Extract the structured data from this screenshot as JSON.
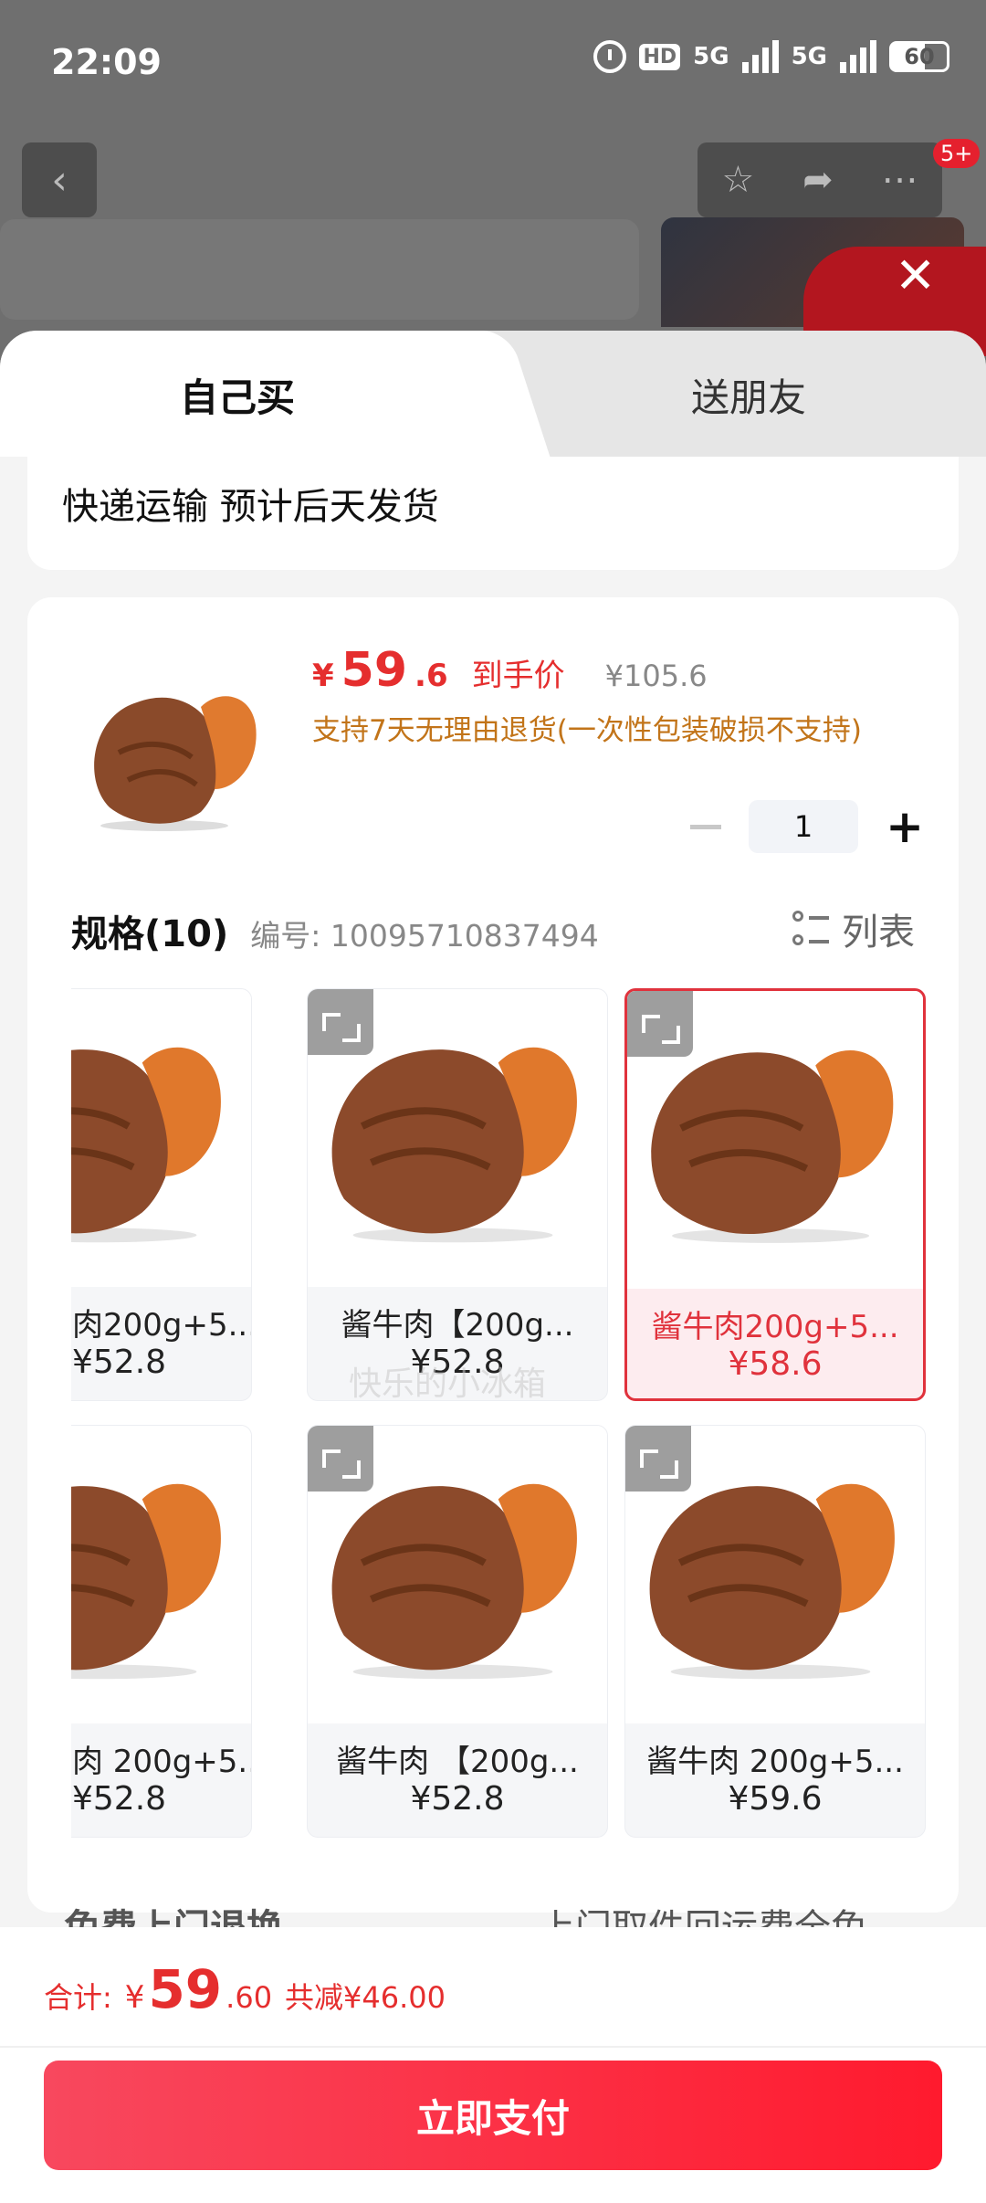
{
  "status_bar": {
    "time": "22:09",
    "hd_label": "HD",
    "net1": "5G",
    "net2": "5G",
    "battery": "60"
  },
  "background_page": {
    "back_icon": "chevron-left-icon",
    "badge": "5+"
  },
  "tabs": {
    "self": "自己买",
    "gift": "送朋友"
  },
  "shipping": {
    "text": "快递运输 预计后天发货"
  },
  "product": {
    "price_currency": "¥",
    "price_int": "59",
    "price_dec": ".6",
    "price_label": "到手价",
    "original_price": "¥105.6",
    "return_policy": "支持7天无理由退货(一次性包装破损不支持)",
    "quantity": "1"
  },
  "spec": {
    "title": "规格(10)",
    "code": "编号: 10095710837494",
    "list_toggle": "列表"
  },
  "skus": [
    {
      "name": "肉200g+5...",
      "price": "¥52.8"
    },
    {
      "name": "酱牛肉【200g...",
      "price": "¥52.8"
    },
    {
      "name": "酱牛肉200g+5...",
      "price": "¥58.6",
      "selected": true
    },
    {
      "name": "肉 200g+5...",
      "price": "¥52.8"
    },
    {
      "name": "酱牛肉 【200g...",
      "price": "¥52.8"
    },
    {
      "name": "酱牛肉 200g+5...",
      "price": "¥59.6"
    }
  ],
  "watermark": "快乐的小冰箱",
  "more_row": {
    "left": "免费上门退换",
    "right": "上门取件回运费全免"
  },
  "footer": {
    "total_label": "合计:",
    "total_currency": "¥",
    "total_int": "59",
    "total_dec": ".60",
    "discount": "共减¥46.00",
    "pay_button": "立即支付"
  },
  "colors": {
    "accent": "#e52e2e",
    "return_text": "#c27419",
    "selected_border": "#e0323c"
  }
}
